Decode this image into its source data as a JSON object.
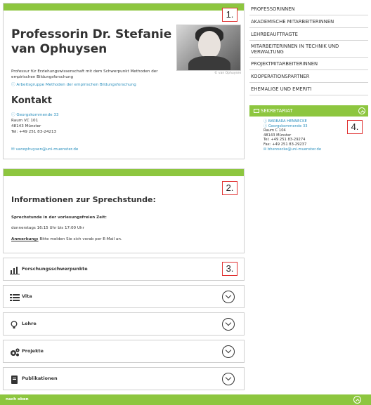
{
  "profile": {
    "title": "Professorin Dr. Stefanie van Ophuysen",
    "photo_credit": "© van Ophuysen",
    "description": "Professur für Erziehungswissenschaft mit dem Schwerpunkt Methoden der empirischen Bildungsforschung",
    "workgroup_link": "ⓘ Arbeitsgruppe Methoden der empirischen Bildungsforschung",
    "contact_heading": "Kontakt",
    "address_link": "ⓘ Georgskommende 33",
    "room": "Raum VC 101",
    "city": "48143 Münster",
    "phone": "Tel: +49 251 83-24213",
    "email": "✉ vanophuysen@uni-muenster.de"
  },
  "office_hours": {
    "title": "Informationen zur Sprechstunde:",
    "subtitle": "Sprechstunde in der vorlesungsfreien Zeit:",
    "time": "donnerstags 16:15 Uhr bis 17:00 Uhr",
    "note_label": "Anmerkung:",
    "note_text": " Bitte melden Sie sich vorab per E-Mail an."
  },
  "markers": [
    "1.",
    "2.",
    "3.",
    "4."
  ],
  "accordions": [
    {
      "label": "Forschungsschwerpunkte",
      "icon": "bar-chart-icon"
    },
    {
      "label": "Vita",
      "icon": "list-icon"
    },
    {
      "label": "Lehre",
      "icon": "lightbulb-icon"
    },
    {
      "label": "Projekte",
      "icon": "gears-icon"
    },
    {
      "label": "Publikationen",
      "icon": "book-icon"
    }
  ],
  "sidenav": [
    "PROFESSORINNEN",
    "AKADEMISCHE MITARBEITERINNEN",
    "LEHRBEAUFTRAGTE",
    "MITARBEITERINNEN IN TECHNIK UND VERWALTUNG",
    "PROJEKTMITARBEITERINNEN",
    "KOOPERATIONSPARTNER",
    "EHEMALIGE UND EMERITI"
  ],
  "secretariat": {
    "heading": "SEKRETARIAT",
    "name_link": "ⓘ BARBARA HENNECKE",
    "address_link": "ⓘ Georgskommende 33",
    "room": "Raum C 104",
    "city": "48143 Münster",
    "phone": "Tel: +49 251 83-29274",
    "fax": "Fax: +49 251 83-29237",
    "email": "✉ bhennecke@uni-muenster.de"
  },
  "footer": {
    "label": "nach oben"
  },
  "colors": {
    "accent_green": "#8dc63f",
    "link_blue": "#2a8fbd",
    "marker_red": "#e03030"
  }
}
